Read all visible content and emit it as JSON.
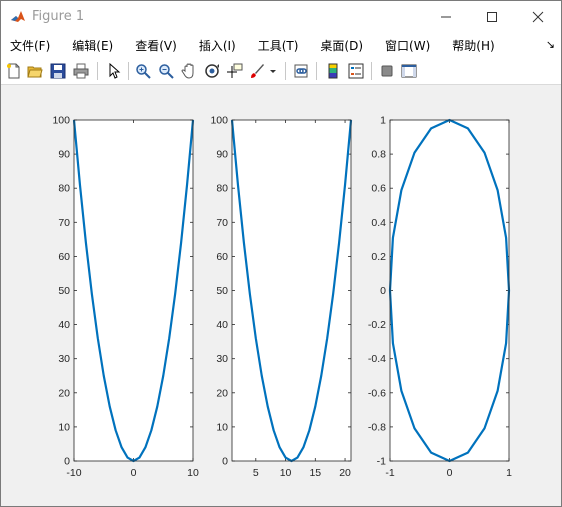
{
  "window": {
    "title": "Figure 1",
    "menu": [
      {
        "id": "file",
        "label": "文件(F)"
      },
      {
        "id": "edit",
        "label": "编辑(E)"
      },
      {
        "id": "view",
        "label": "查看(V)"
      },
      {
        "id": "insert",
        "label": "插入(I)"
      },
      {
        "id": "tools",
        "label": "工具(T)"
      },
      {
        "id": "desktop",
        "label": "桌面(D)"
      },
      {
        "id": "window",
        "label": "窗口(W)"
      },
      {
        "id": "help",
        "label": "帮助(H)"
      }
    ],
    "toolbar_icons": [
      "new-figure-icon",
      "open-file-icon",
      "save-icon",
      "print-icon",
      "edit-plot-arrow-icon",
      "zoom-in-icon",
      "zoom-out-icon",
      "pan-hand-icon",
      "rotate-3d-icon",
      "data-cursor-icon",
      "brush-icon",
      "brush-dropdown-icon",
      "link-plot-icon",
      "insert-colorbar-icon",
      "insert-legend-icon",
      "hide-plot-tools-icon",
      "show-plot-tools-icon"
    ],
    "colors": {
      "line": "#0072bd",
      "axes_bg": "#ffffff",
      "figure_bg": "#f0f0f0"
    }
  },
  "chart_data": [
    {
      "type": "line",
      "x": [
        -10,
        -9,
        -8,
        -7,
        -6,
        -5,
        -4,
        -3,
        -2,
        -1,
        0,
        1,
        2,
        3,
        4,
        5,
        6,
        7,
        8,
        9,
        10
      ],
      "y": [
        100,
        81,
        64,
        49,
        36,
        25,
        16,
        9,
        4,
        1,
        0,
        1,
        4,
        9,
        16,
        25,
        36,
        49,
        64,
        81,
        100
      ],
      "xlim": [
        -10,
        10
      ],
      "ylim": [
        0,
        100
      ],
      "xticks": [
        -10,
        0,
        10
      ],
      "yticks": [
        0,
        10,
        20,
        30,
        40,
        50,
        60,
        70,
        80,
        90,
        100
      ],
      "color": "#0072bd",
      "grid": false
    },
    {
      "type": "line",
      "x": [
        1,
        2,
        3,
        4,
        5,
        6,
        7,
        8,
        9,
        10,
        11,
        12,
        13,
        14,
        15,
        16,
        17,
        18,
        19,
        20,
        21
      ],
      "y": [
        100,
        81,
        64,
        49,
        36,
        25,
        16,
        9,
        4,
        1,
        0,
        1,
        4,
        9,
        16,
        25,
        36,
        49,
        64,
        81,
        100
      ],
      "xlim": [
        1,
        21
      ],
      "ylim": [
        0,
        100
      ],
      "xticks": [
        5,
        10,
        15,
        20
      ],
      "yticks": [
        0,
        10,
        20,
        30,
        40,
        50,
        60,
        70,
        80,
        90,
        100
      ],
      "color": "#0072bd",
      "grid": false
    },
    {
      "type": "line",
      "x": [
        1,
        0.9511,
        0.809,
        0.5878,
        0.309,
        0,
        -0.309,
        -0.5878,
        -0.809,
        -0.9511,
        -1,
        -0.9511,
        -0.809,
        -0.5878,
        -0.309,
        0,
        0.309,
        0.5878,
        0.809,
        0.9511,
        1
      ],
      "y": [
        0,
        0.309,
        0.5878,
        0.809,
        0.9511,
        1,
        0.9511,
        0.809,
        0.5878,
        0.309,
        0,
        -0.309,
        -0.5878,
        -0.809,
        -0.9511,
        -1,
        -0.9511,
        -0.809,
        -0.5878,
        -0.309,
        0
      ],
      "xlim": [
        -1,
        1
      ],
      "ylim": [
        -1,
        1
      ],
      "xticks": [
        -1,
        0,
        1
      ],
      "yticks": [
        -1,
        -0.8,
        -0.6,
        -0.4,
        -0.2,
        0,
        0.2,
        0.4,
        0.6,
        0.8,
        1
      ],
      "color": "#0072bd",
      "grid": false
    }
  ]
}
